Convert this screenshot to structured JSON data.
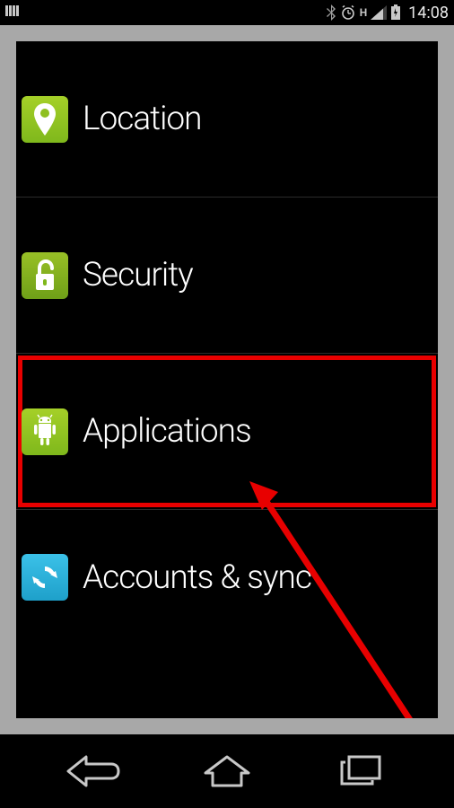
{
  "status_bar": {
    "network_type": "H",
    "time": "14:08"
  },
  "settings": {
    "items": [
      {
        "label": "Location"
      },
      {
        "label": "Security"
      },
      {
        "label": "Applications"
      },
      {
        "label": "Accounts & sync"
      }
    ]
  },
  "highlight_index": 2,
  "colors": {
    "highlight": "#e80000",
    "arrow": "#e80000",
    "icon_green": "#8fc020",
    "icon_cyan": "#2fb0d8"
  }
}
